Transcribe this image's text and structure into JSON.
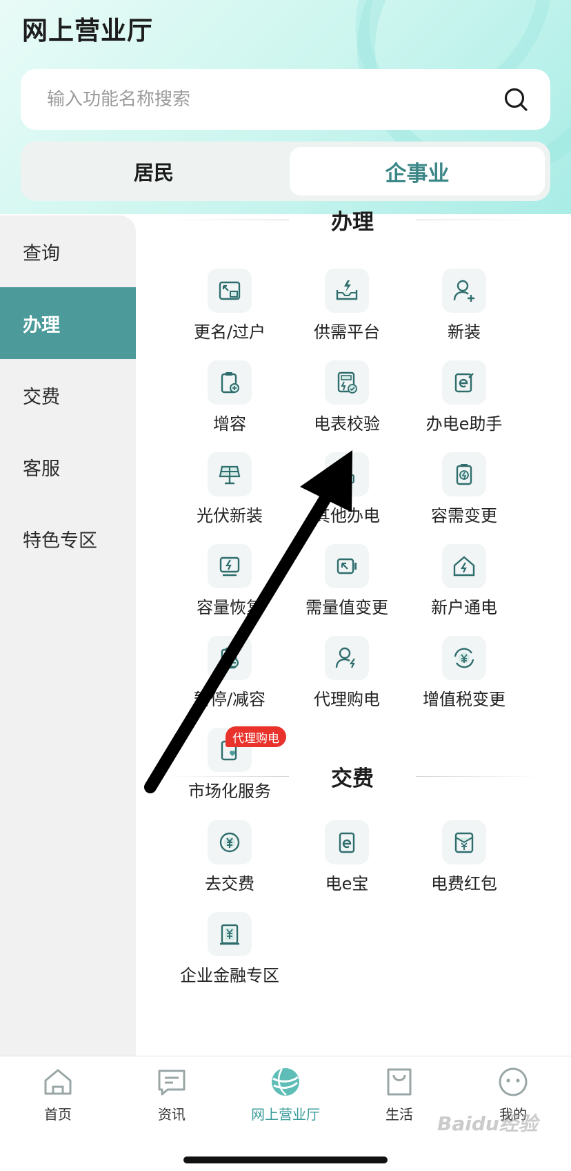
{
  "header": {
    "title": "网上营业厅",
    "search_placeholder": "输入功能名称搜索",
    "segments": [
      "居民",
      "企事业"
    ],
    "active_segment": "企事业"
  },
  "sidebar": {
    "items": [
      "查询",
      "办理",
      "交费",
      "客服",
      "特色专区"
    ],
    "active": "办理"
  },
  "sections": {
    "handle": {
      "title": "办理",
      "items": [
        {
          "label": "更名/过户",
          "icon": "rename-transfer-icon"
        },
        {
          "label": "供需平台",
          "icon": "supply-demand-icon"
        },
        {
          "label": "新装",
          "icon": "add-user-icon"
        },
        {
          "label": "增容",
          "icon": "clipboard-plus-icon"
        },
        {
          "label": "电表校验",
          "icon": "meter-check-icon"
        },
        {
          "label": "办电e助手",
          "icon": "e-assistant-icon"
        },
        {
          "label": "光伏新装",
          "icon": "solar-panel-icon"
        },
        {
          "label": "其他办电",
          "icon": "other-power-icon"
        },
        {
          "label": "容需变更",
          "icon": "battery-change-icon"
        },
        {
          "label": "容量恢复",
          "icon": "capacity-restore-icon"
        },
        {
          "label": "需量值变更",
          "icon": "demand-change-icon"
        },
        {
          "label": "新户通电",
          "icon": "house-power-icon"
        },
        {
          "label": "暂停/减容",
          "icon": "clipboard-minus-icon"
        },
        {
          "label": "代理购电",
          "icon": "proxy-purchase-icon"
        },
        {
          "label": "增值税变更",
          "icon": "vat-change-icon"
        },
        {
          "label": "市场化服务",
          "icon": "market-service-icon"
        }
      ],
      "badge": "代理购电"
    },
    "pay": {
      "title": "交费",
      "items": [
        {
          "label": "去交费",
          "icon": "yuan-coin-icon"
        },
        {
          "label": "电e宝",
          "icon": "e-wallet-icon"
        },
        {
          "label": "电费红包",
          "icon": "red-envelope-icon"
        },
        {
          "label": "企业金融专区",
          "icon": "finance-icon"
        }
      ]
    }
  },
  "tabbar": {
    "items": [
      {
        "label": "首页",
        "icon": "home-icon"
      },
      {
        "label": "资讯",
        "icon": "message-icon"
      },
      {
        "label": "网上营业厅",
        "icon": "globe-icon"
      },
      {
        "label": "生活",
        "icon": "shopping-bag-icon"
      },
      {
        "label": "我的",
        "icon": "smiley-icon"
      }
    ],
    "active": "网上营业厅"
  },
  "watermark": "Baidu经验",
  "colors": {
    "accent": "#4c9a9a",
    "accent_text": "#3b8686",
    "badge": "#e8322b",
    "icon_stroke": "#2f6d6d"
  }
}
